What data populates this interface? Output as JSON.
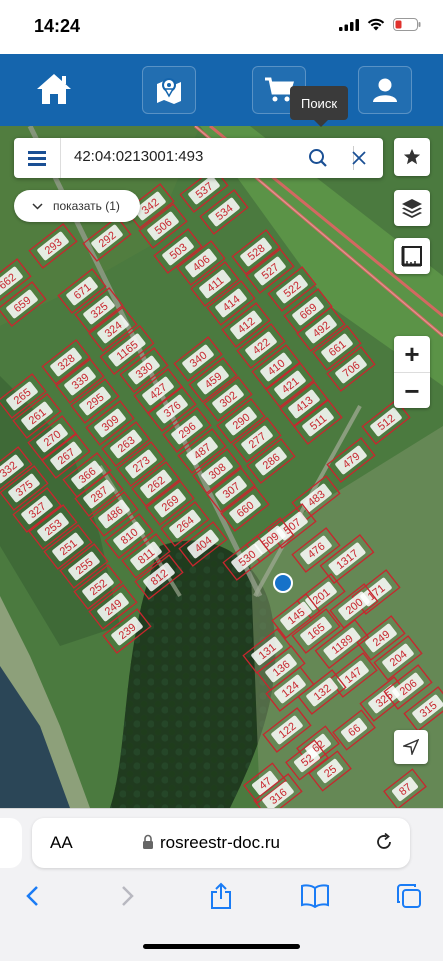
{
  "status": {
    "time": "14:24"
  },
  "appbar": {
    "home": "home-icon",
    "map": "map-pin-icon",
    "cart": "cart-icon",
    "user": "user-icon",
    "tooltip": "Поиск"
  },
  "search": {
    "value": "42:04:0213001:493",
    "menu_icon": "hamburger-menu-icon",
    "search_icon": "search-icon",
    "clear_icon": "close-icon"
  },
  "show_chip": {
    "label": "показать (1)"
  },
  "map": {
    "parcel_labels": [
      "503",
      "537",
      "534",
      "506",
      "342",
      "293",
      "292",
      "406",
      "528",
      "411",
      "527",
      "671",
      "522",
      "414",
      "662",
      "659",
      "325",
      "669",
      "412",
      "324",
      "492",
      "422",
      "1165",
      "661",
      "328",
      "340",
      "410",
      "706",
      "339",
      "330",
      "459",
      "421",
      "265",
      "427",
      "302",
      "413",
      "261",
      "295",
      "376",
      "290",
      "309",
      "296",
      "511",
      "270",
      "277",
      "263",
      "487",
      "267",
      "273",
      "479",
      "332",
      "308",
      "286",
      "366",
      "512",
      "375",
      "262",
      "287",
      "307",
      "483",
      "269",
      "486",
      "327",
      "660",
      "264",
      "810",
      "253",
      "507",
      "251",
      "811",
      "509",
      "404",
      "476",
      "255",
      "530",
      "812",
      "252",
      "1317",
      "201",
      "249",
      "145",
      "171",
      "239",
      "200",
      "1189",
      "165",
      "131",
      "249",
      "136",
      "204",
      "124",
      "147",
      "132",
      "325",
      "206",
      "315",
      "122",
      "62",
      "52",
      "25",
      "66",
      "47",
      "316",
      "87"
    ],
    "colors": {
      "parcel": "#c8262e",
      "road": "#e06464",
      "water": "#2b4657"
    }
  },
  "browser": {
    "aa": "AA",
    "url": "rosreestr-doc.ru"
  }
}
